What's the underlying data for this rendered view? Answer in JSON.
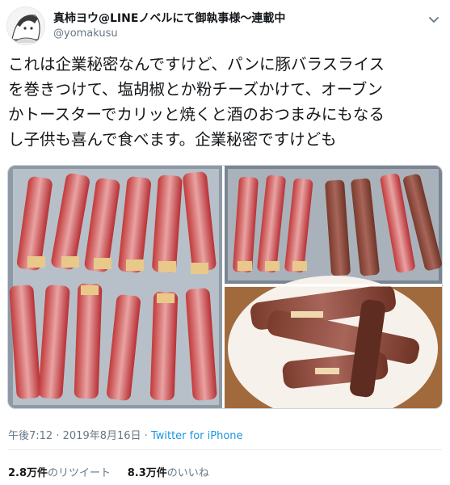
{
  "tweet": {
    "display_name": "真柿ヨウ@LINEノベルにて御執事様〜連載中",
    "handle": "@yomakusu",
    "text_lines": [
      "これは企業秘密なんですけど、パンに豚バラスライス",
      "を巻きつけて、塩胡椒とか粉チーズかけて、オーブン",
      "かトースターでカリッと焼くと酒のおつまみにもなる",
      "し子供も喜んで食べます。企業秘密ですけども"
    ],
    "time": "午後7:12",
    "date": "2019年8月16日",
    "separator": "·",
    "via": "Twitter for iPhone",
    "retweets_count": "2.8万件",
    "retweets_label": "のリツイート",
    "likes_count": "8.3万件",
    "likes_label": "のいいね"
  },
  "icons": {
    "avatar": "avatar-illustration",
    "menu": "chevron-down-icon"
  },
  "colors": {
    "link": "#1b95e0",
    "secondary_text": "#657786",
    "primary_text": "#14171a"
  }
}
